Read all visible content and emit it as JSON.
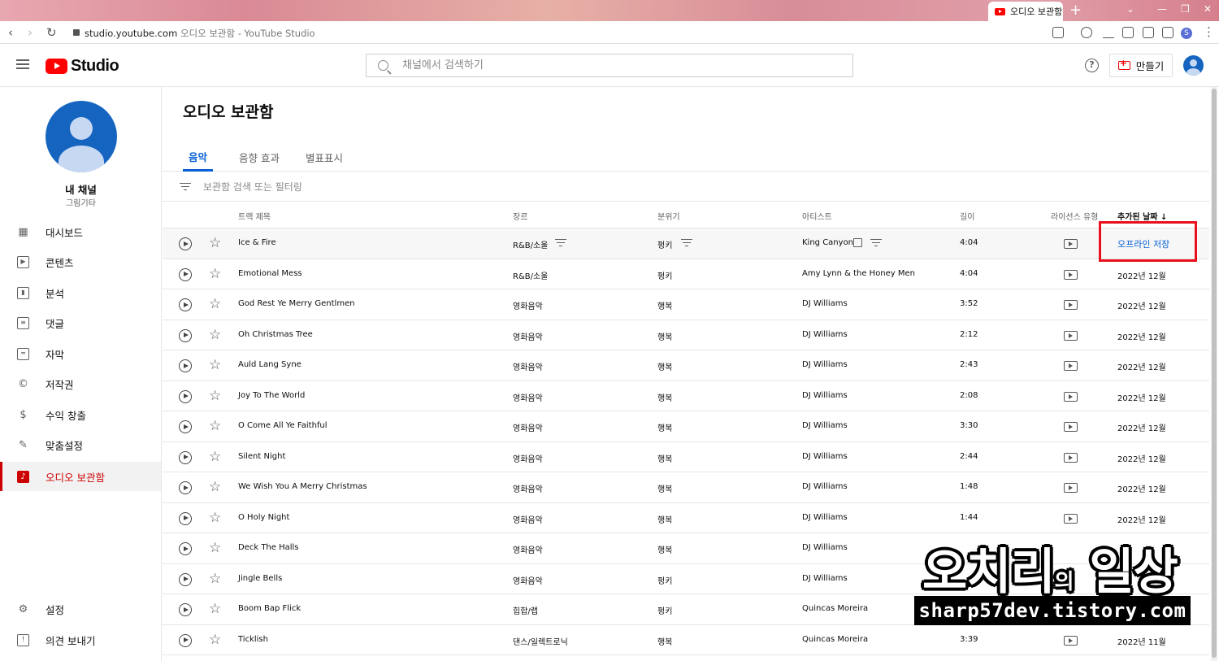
{
  "browser": {
    "tab_title": "오디오 보관함",
    "new_tab": "+",
    "url_domain": "studio.youtube.com",
    "url_title": " 오디오 보관함 - YouTube Studio",
    "profile_letter": "S"
  },
  "header": {
    "logo_text": "Studio",
    "search_placeholder": "채널에서 검색하기",
    "help_label": "?",
    "create_label": "만들기"
  },
  "sidebar": {
    "channel_name": "내 채널",
    "channel_sub": "그림기타",
    "items": [
      {
        "label": "대시보드",
        "icon": "dashboard-icon"
      },
      {
        "label": "콘텐츠",
        "icon": "content-icon"
      },
      {
        "label": "분석",
        "icon": "analytics-icon"
      },
      {
        "label": "댓글",
        "icon": "comments-icon"
      },
      {
        "label": "자막",
        "icon": "subtitles-icon"
      },
      {
        "label": "저작권",
        "icon": "copyright-icon"
      },
      {
        "label": "수익 창출",
        "icon": "monetization-icon"
      },
      {
        "label": "맞춤설정",
        "icon": "customization-icon"
      },
      {
        "label": "오디오 보관함",
        "icon": "audio-library-icon"
      }
    ],
    "settings_label": "설정",
    "feedback_label": "의견 보내기"
  },
  "main": {
    "title": "오디오 보관함",
    "tabs": [
      {
        "label": "음악"
      },
      {
        "label": "음향 효과"
      },
      {
        "label": "별표표시"
      }
    ],
    "filter_placeholder": "보관함 검색 또는 필터링",
    "columns": {
      "track": "트랙 제목",
      "genre": "장르",
      "mood": "분위기",
      "artist": "아티스트",
      "length": "길이",
      "license": "라이선스 유형",
      "added": "추가된 날짜 ↓"
    },
    "offline_save_label": "오프라인 저장",
    "rows": [
      {
        "title": "Ice & Fire",
        "genre": "R&B/소울",
        "mood": "펑키",
        "artist": "King Canyon",
        "length": "4:04",
        "added": ""
      },
      {
        "title": "Emotional Mess",
        "genre": "R&B/소울",
        "mood": "펑키",
        "artist": "Amy Lynn & the Honey Men",
        "length": "4:04",
        "added": "2022년 12월"
      },
      {
        "title": "God Rest Ye Merry Gentlmen",
        "genre": "영화음악",
        "mood": "행복",
        "artist": "DJ Williams",
        "length": "3:52",
        "added": "2022년 12월"
      },
      {
        "title": "Oh Christmas Tree",
        "genre": "영화음악",
        "mood": "행복",
        "artist": "DJ Williams",
        "length": "2:12",
        "added": "2022년 12월"
      },
      {
        "title": "Auld Lang Syne",
        "genre": "영화음악",
        "mood": "행복",
        "artist": "DJ Williams",
        "length": "2:43",
        "added": "2022년 12월"
      },
      {
        "title": "Joy To The World",
        "genre": "영화음악",
        "mood": "행복",
        "artist": "DJ Williams",
        "length": "2:08",
        "added": "2022년 12월"
      },
      {
        "title": "O Come All Ye Faithful",
        "genre": "영화음악",
        "mood": "행복",
        "artist": "DJ Williams",
        "length": "3:30",
        "added": "2022년 12월"
      },
      {
        "title": "Silent Night",
        "genre": "영화음악",
        "mood": "행복",
        "artist": "DJ Williams",
        "length": "2:44",
        "added": "2022년 12월"
      },
      {
        "title": "We Wish You A Merry Christmas",
        "genre": "영화음악",
        "mood": "행복",
        "artist": "DJ Williams",
        "length": "1:48",
        "added": "2022년 12월"
      },
      {
        "title": "O Holy Night",
        "genre": "영화음악",
        "mood": "행복",
        "artist": "DJ Williams",
        "length": "1:44",
        "added": "2022년 12월"
      },
      {
        "title": "Deck The Halls",
        "genre": "영화음악",
        "mood": "행복",
        "artist": "DJ Williams",
        "length": "",
        "added": ""
      },
      {
        "title": "Jingle Bells",
        "genre": "영화음악",
        "mood": "펑키",
        "artist": "DJ Williams",
        "length": "",
        "added": ""
      },
      {
        "title": "Boom Bap Flick",
        "genre": "힙합/랩",
        "mood": "펑키",
        "artist": "Quincas Moreira",
        "length": "",
        "added": ""
      },
      {
        "title": "Ticklish",
        "genre": "댄스/일렉트로닉",
        "mood": "행복",
        "artist": "Quincas Moreira",
        "length": "3:39",
        "added": "2022년 11월"
      }
    ]
  },
  "watermark": {
    "line1_a": "오치리",
    "line1_b": "의",
    "line1_c": " 일상",
    "line2": "sharp57dev.tistory.com"
  },
  "colors": {
    "accent_blue": "#065fd4",
    "active_red": "#cc0000",
    "highlight_box": "#e8101d",
    "youtube_red": "#ff0000"
  }
}
